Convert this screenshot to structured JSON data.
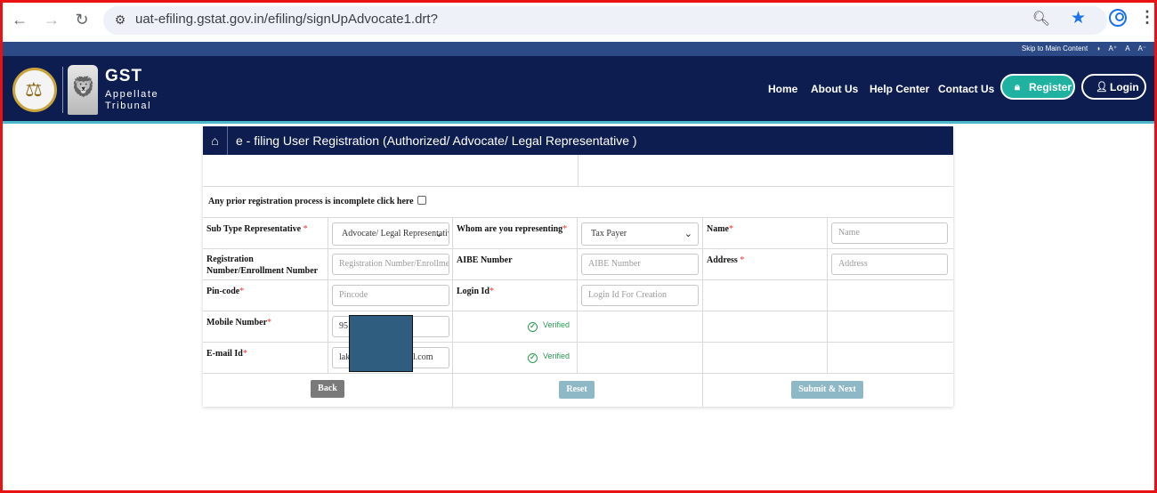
{
  "browser": {
    "url": "uat-efiling.gstat.gov.in/efiling/signUpAdvocate1.drt?"
  },
  "site": {
    "accessibility": [
      "Skip to Main Content",
      "◑",
      "A⁺",
      "A",
      "A⁻"
    ],
    "brand_main": "GST",
    "brand_sub": "Appellate Tribunal",
    "nav": [
      "Home",
      "About Us",
      "Help Center",
      "Contact Us"
    ],
    "register_label": "Register",
    "login_label": "Login"
  },
  "form": {
    "title": "e - filing User Registration (Authorized/ Advocate/ Legal Representative )",
    "prior_registration": "Any prior registration process is incomplete click here",
    "fields": {
      "sub_type": {
        "label": "Sub Type Representative",
        "value": "Advocate/ Legal Representative"
      },
      "whom": {
        "label": "Whom are you representing",
        "value": "Tax Payer"
      },
      "name": {
        "label": "Name",
        "placeholder": "Name"
      },
      "reg_no": {
        "label": "Registration Number/Enrollment Number",
        "placeholder": "Registration Number/Enrollment Number"
      },
      "aibe": {
        "label": "AIBE Number",
        "placeholder": "AIBE Number"
      },
      "address": {
        "label": "Address",
        "placeholder": "Address"
      },
      "pincode": {
        "label": "Pin-code",
        "placeholder": "Pincode"
      },
      "login_id": {
        "label": "Login Id",
        "placeholder": "Login Id For Creation"
      },
      "mobile": {
        "label": "Mobile Number",
        "value": "95"
      },
      "email": {
        "label": "E-mail Id",
        "value_start": "lak",
        "value_end": "l.com"
      }
    },
    "verified_label": "Verified",
    "required_mark": "*",
    "buttons": {
      "back": "Back",
      "reset": "Reset",
      "submit": "Submit & Next"
    }
  }
}
